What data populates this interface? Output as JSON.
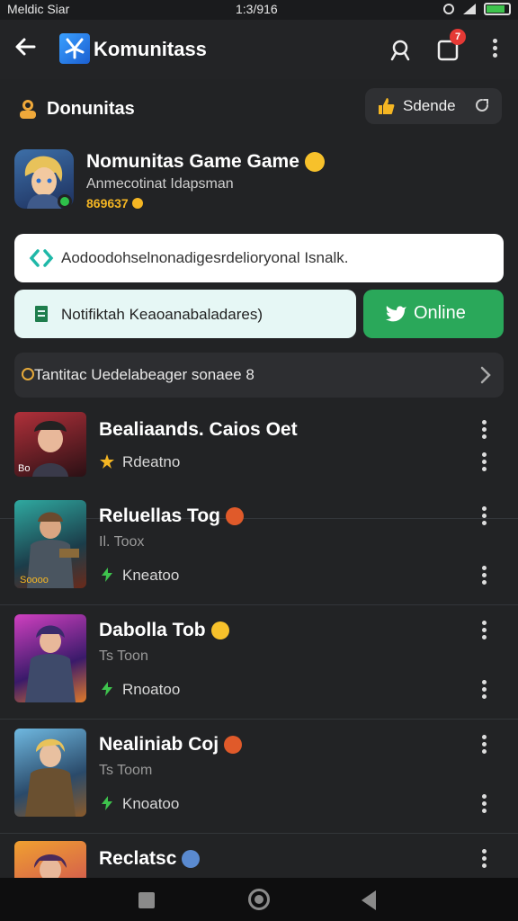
{
  "status_bar": {
    "carrier": "Meldic Siar",
    "time": "1:3/916"
  },
  "app_bar": {
    "title": "Komunitass",
    "notification_count": "7"
  },
  "section": {
    "title": "Donunitas",
    "share_label": "Sdende"
  },
  "profile": {
    "name": "Nomunitas Game Game",
    "subtitle": "Anmecotinat Idapsman",
    "score": "869637"
  },
  "description": {
    "text": "Aodoodohselnonadigesrdelioryonal Isnalk."
  },
  "notification": {
    "text": "Notifiktah Keaoanabaladares)"
  },
  "online_button": {
    "label": "Online"
  },
  "feature_row": {
    "text": "Tantitac Uedelabeager sonaee 8"
  },
  "games": [
    {
      "name": "Bealiaands. Caios Oet",
      "subtitle": "",
      "status": "Rdeatno",
      "thumb_caption": "Bo"
    },
    {
      "name": "Reluellas Tog",
      "subtitle": "Il. Toox",
      "status": "Kneatoo",
      "thumb_caption": "Soooo"
    },
    {
      "name": "Dabolla Tob",
      "subtitle": "Ts Toon",
      "status": "Rnoatoo",
      "thumb_caption": ""
    },
    {
      "name": "Nealiniab Coj",
      "subtitle": "Ts Toom",
      "status": "Knoatoo",
      "thumb_caption": ""
    },
    {
      "name": "Reclatsc",
      "subtitle": "",
      "status": "",
      "thumb_caption": ""
    }
  ],
  "colors": {
    "background": "#222325",
    "online_green": "#2aa85a",
    "accent_blue": "#3aa0ff",
    "badge_red": "#e53935",
    "score_gold": "#f5b623"
  },
  "icons": {
    "app_bar": [
      "back-arrow-icon",
      "app-logo-icon",
      "search-icon",
      "inbox-icon",
      "more-vertical-icon"
    ],
    "section": [
      "community-icon",
      "thumbs-up-icon",
      "external-link-icon"
    ],
    "rows": [
      "chain-link-icon",
      "document-icon",
      "bird-icon",
      "chevron-right-icon",
      "star-icon",
      "bolt-icon"
    ]
  }
}
